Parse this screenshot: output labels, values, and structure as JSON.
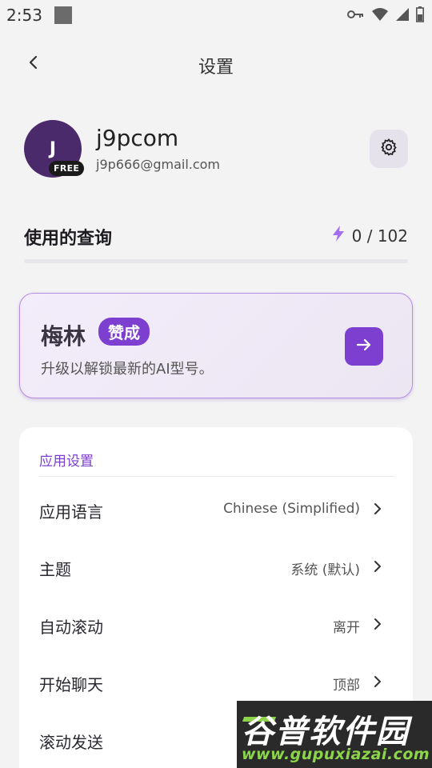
{
  "status_bar": {
    "time": "2:53",
    "icons": [
      "key-icon",
      "wifi-icon",
      "signal-icon",
      "battery-icon"
    ]
  },
  "header": {
    "title": "设置",
    "back_icon": "chevron-left-icon"
  },
  "profile": {
    "avatar_initial": "J",
    "plan_badge": "FREE",
    "username": "j9pcom",
    "email": "j9p666@gmail.com",
    "settings_icon": "gear-icon",
    "avatar_color": "#4b2a6b"
  },
  "usage": {
    "label": "使用的查询",
    "count": "0 / 102",
    "used": 0,
    "limit": 102,
    "fraction": 0.0,
    "icon": "lightning-icon"
  },
  "promo": {
    "title": "梅林",
    "badge": "赞成",
    "subtitle": "升级以解锁最新的AI型号。",
    "arrow_icon": "arrow-right-icon",
    "accent_color": "#7d3fd0"
  },
  "app_settings": {
    "section_title": "应用设置",
    "rows": [
      {
        "label": "应用语言",
        "value": "Chinese (Simplified)"
      },
      {
        "label": "主题",
        "value": "系统 (默认)"
      },
      {
        "label": "自动滚动",
        "value": "离开"
      },
      {
        "label": "开始聊天",
        "value": "顶部"
      },
      {
        "label": "滚动发送",
        "value": ""
      }
    ]
  },
  "watermark": {
    "title": "谷普软件园",
    "url": "www.gupuxiazai.com"
  }
}
